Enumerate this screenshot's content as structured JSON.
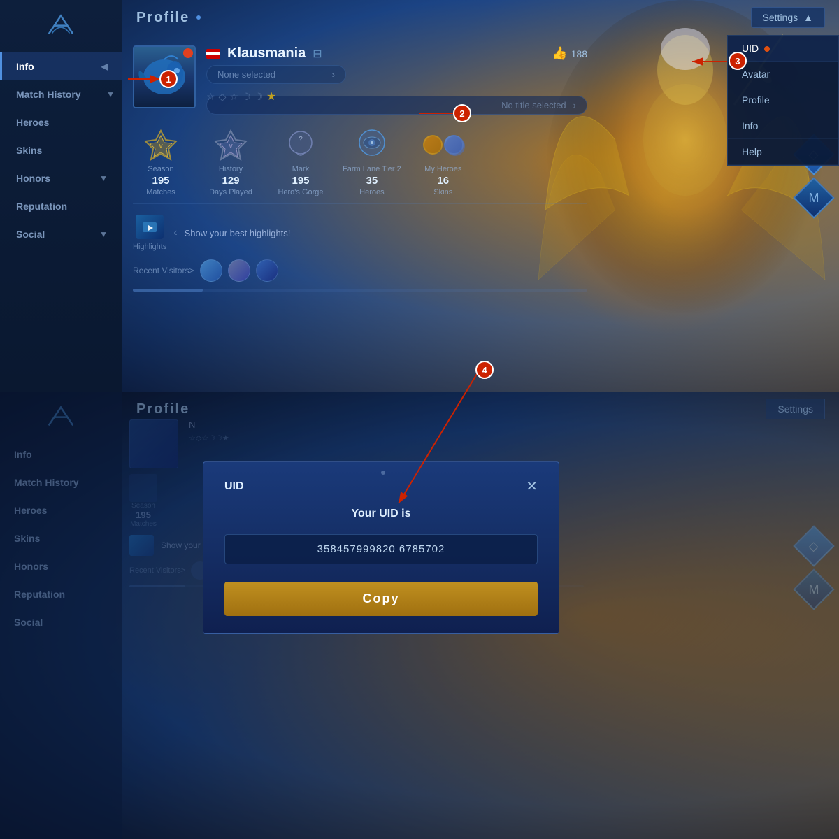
{
  "app": {
    "logo_text": "⟵",
    "title": "Profile",
    "settings_label": "Settings"
  },
  "sidebar": {
    "items": [
      {
        "id": "info",
        "label": "Info",
        "active": true,
        "has_dot": false,
        "has_arrow": true
      },
      {
        "id": "match-history",
        "label": "Match History",
        "active": false,
        "has_arrow": true
      },
      {
        "id": "heroes",
        "label": "Heroes",
        "active": false,
        "has_arrow": false
      },
      {
        "id": "skins",
        "label": "Skins",
        "active": false,
        "has_arrow": false
      },
      {
        "id": "honors",
        "label": "Honors",
        "active": false,
        "has_arrow": true
      },
      {
        "id": "reputation",
        "label": "Reputation",
        "active": false,
        "has_arrow": false
      },
      {
        "id": "social",
        "label": "Social",
        "active": false,
        "has_arrow": true
      }
    ]
  },
  "settings_dropdown": {
    "items": [
      {
        "id": "uid",
        "label": "UID",
        "active": true,
        "has_dot": true
      },
      {
        "id": "avatar",
        "label": "Avatar",
        "active": false
      },
      {
        "id": "profile",
        "label": "Profile",
        "active": false
      },
      {
        "id": "info",
        "label": "Info",
        "active": false
      },
      {
        "id": "help",
        "label": "Help",
        "active": false
      }
    ]
  },
  "player": {
    "name": "Klausmania",
    "likes": "188",
    "role": "None selected",
    "title": "No title selected",
    "stars": "☆◇☆☾☾★"
  },
  "stats": [
    {
      "id": "season",
      "label": "Season",
      "value": "195",
      "sub": "Matches"
    },
    {
      "id": "history",
      "label": "History",
      "value": "129",
      "sub": "Days Played"
    },
    {
      "id": "mark",
      "label": "Mark",
      "value": "195",
      "sub": "Hero's Gorge"
    },
    {
      "id": "farm-lane",
      "label": "Farm Lane Tier 2",
      "value": "35",
      "sub": "Heroes"
    },
    {
      "id": "my-heroes",
      "label": "My Heroes",
      "value": "16",
      "sub": "Skins"
    }
  ],
  "highlights": {
    "label": "Highlights",
    "text": "Show your best highlights!"
  },
  "visitors": {
    "label": "Recent Visitors>"
  },
  "uid_modal": {
    "title": "UID",
    "subtitle": "Your UID is",
    "uid_value": "358457999820 6785702",
    "copy_label": "Copy",
    "close_icon": "✕"
  },
  "annotations": [
    {
      "id": "1",
      "label": "1"
    },
    {
      "id": "2",
      "label": "2"
    },
    {
      "id": "3",
      "label": "3"
    },
    {
      "id": "4",
      "label": "4"
    }
  ]
}
